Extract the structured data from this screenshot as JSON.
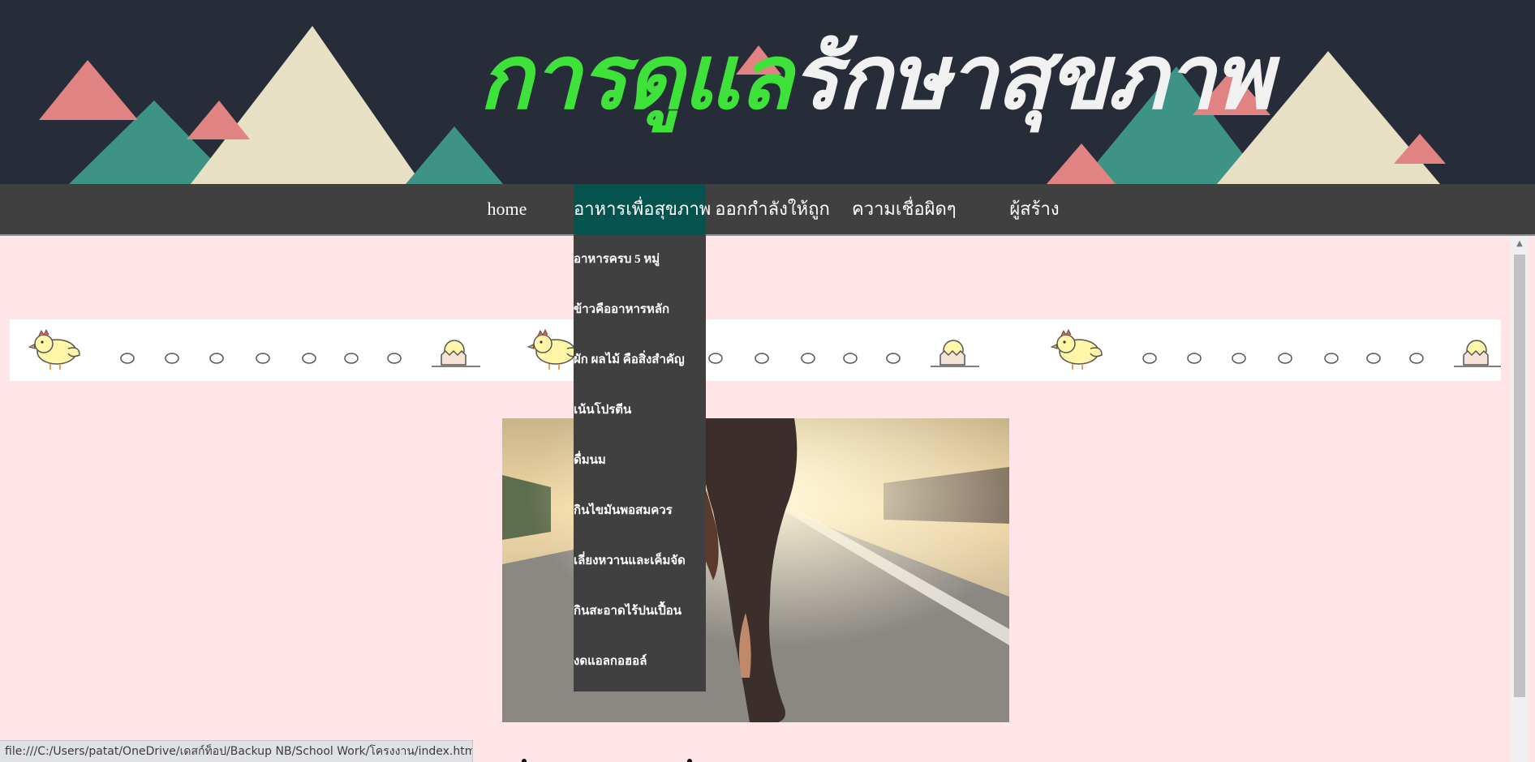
{
  "header": {
    "title_part1": "การดูแล",
    "title_part2": "รักษาสุขภาพ"
  },
  "nav": {
    "items": [
      {
        "label": "home"
      },
      {
        "label": "อาหารเพื่อสุขภาพ"
      },
      {
        "label": "ออกกำลังให้ถูก"
      },
      {
        "label": "ความเชื่อผิดๆ"
      },
      {
        "label": "ผู้สร้าง"
      }
    ]
  },
  "dropdown": {
    "items": [
      {
        "label": "อาหารครบ 5 หมู่"
      },
      {
        "label": "ข้าวคืออาหารหลัก"
      },
      {
        "label": "ผัก ผลไม้ คือสิ่งสำคัญ"
      },
      {
        "label": "เน้นโปรตีน"
      },
      {
        "label": "ดื่มนม"
      },
      {
        "label": "กินไขมันพอสมควร"
      },
      {
        "label": "เลี่ยงหวานและเค็มจัด"
      },
      {
        "label": "กินสะอาดไร้ปนเปื้อน"
      },
      {
        "label": "งดแอลกอฮอล์"
      }
    ]
  },
  "statusbar": {
    "url": "file:///C:/Users/patat/OneDrive/เดสก์ท็อป/Backup NB/School Work/โครงงาน/index.html#"
  },
  "colors": {
    "banner_bg": "#272d38",
    "nav_bg": "#404040",
    "nav_active": "#05534f",
    "page_bg": "#ffe4e8",
    "title_green": "#3fe23a"
  }
}
